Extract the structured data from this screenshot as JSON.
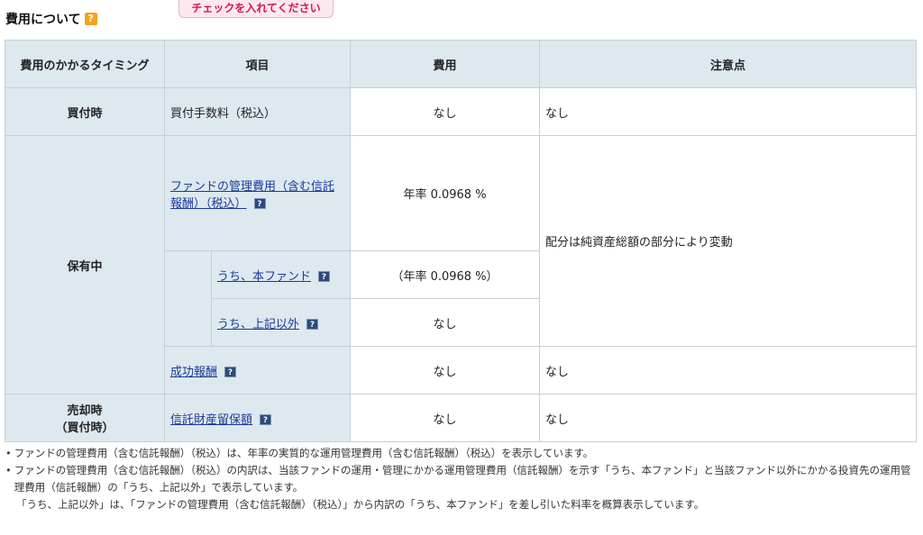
{
  "header": {
    "title": "費用について",
    "help_label": "?"
  },
  "notice": "チェックを入れてください",
  "table": {
    "headers": [
      "費用のかかるタイミング",
      "項目",
      "費用",
      "注意点"
    ],
    "rows": {
      "buy": {
        "timing": "買付時",
        "item": "買付手数料（税込）",
        "cost": "なし",
        "note": "なし"
      },
      "hold": {
        "timing": "保有中",
        "mgmt_item": "ファンドの管理費用（含む信託報酬）（税込）",
        "mgmt_cost": "年率 0.0968 %",
        "mgmt_note": "配分は純資産総額の部分により変動",
        "sub1_item": "うち、本ファンド",
        "sub1_cost": "（年率 0.0968 %）",
        "sub2_item": "うち、上記以外",
        "sub2_cost": "なし",
        "perf_item": "成功報酬",
        "perf_cost": "なし",
        "perf_note": "なし"
      },
      "sell": {
        "timing_line1": "売却時",
        "timing_line2": "（買付時）",
        "item": "信託財産留保額",
        "cost": "なし",
        "note": "なし"
      }
    }
  },
  "icons": {
    "help": "question-icon"
  },
  "notes": {
    "bullet": "•",
    "note1": "ファンドの管理費用（含む信託報酬）（税込）は、年率の実質的な運用管理費用（含む信託報酬）（税込）を表示しています。",
    "note2": "ファンドの管理費用（含む信託報酬）（税込）の内訳は、当該ファンドの運用・管理にかかる運用管理費用（信託報酬）を示す「うち、本ファンド」と当該ファンド以外にかかる投資先の運用管理費用（信託報酬）の「うち、上記以外」で表示しています。",
    "note3": "「うち、上記以外」は、「ファンドの管理費用（含む信託報酬）（税込）」から内訳の「うち、本ファンド」を差し引いた料率を概算表示しています。"
  }
}
